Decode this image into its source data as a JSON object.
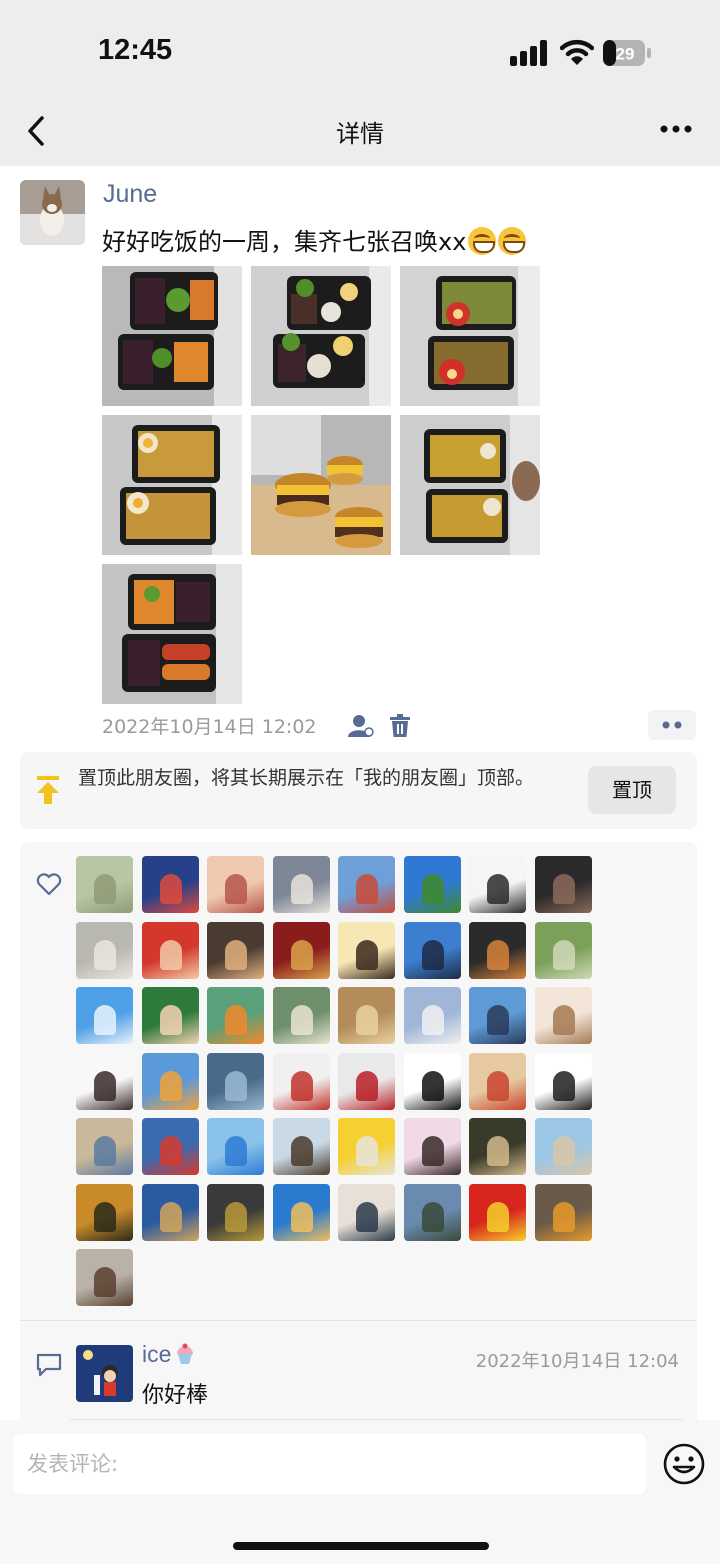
{
  "status": {
    "time": "12:45",
    "battery": "29"
  },
  "nav": {
    "title": "详情"
  },
  "post": {
    "author": "June",
    "text": "好好吃饭的一周，集齐七张召唤xx",
    "timestamp": "2022年10月14日 12:02",
    "photo_count": 7
  },
  "pin": {
    "text": "置顶此朋友圈，将其长期展示在「我的朋友圈」顶部。",
    "button": "置顶"
  },
  "likes": {
    "count": 50
  },
  "comment": {
    "name": "ice",
    "time": "2022年10月14日 12:04",
    "text": "你好棒"
  },
  "composer": {
    "placeholder": "发表评论:"
  },
  "icons": {
    "back": "chevron-left-icon",
    "more": "more-icon",
    "visibility": "person-icon",
    "delete": "trash-icon",
    "pin": "pin-top-icon",
    "like": "heart-icon",
    "comment": "comment-icon",
    "emoji": "emoji-icon"
  },
  "colors": {
    "link": "#576b95",
    "pin": "#f4c21c",
    "nav_bg": "#ededed"
  }
}
